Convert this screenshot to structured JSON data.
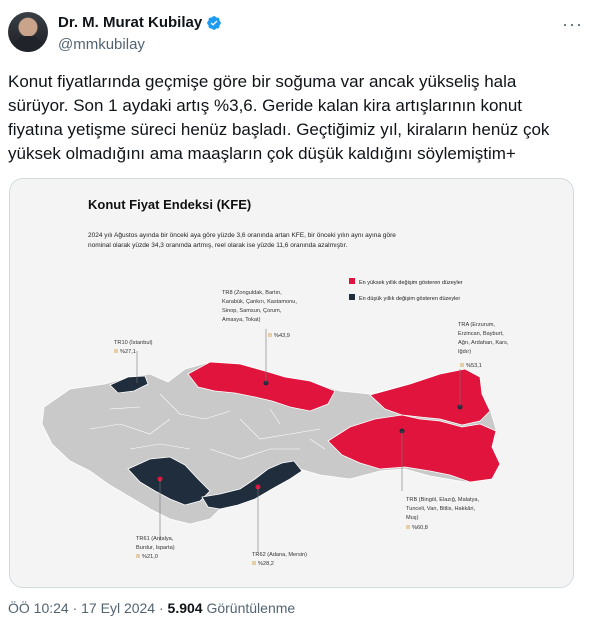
{
  "author": {
    "name": "Dr. M. Murat Kubilay",
    "handle": "@mmkubilay",
    "more_icon": "···"
  },
  "post_text": "Konut fiyatlarında geçmişe göre bir soğuma var ancak yükseliş hala sürüyor. Son 1 aydaki artış %3,6. Geride kalan kira artışlarının konut fiyatına yetişme süreci henüz başladı. Geçtiğimiz yıl, kiraların henüz çok yüksek olmadığını ama maaşların çok düşük kaldığını söylemiştim+",
  "infographic": {
    "title": "Konut Fiyat Endeksi (KFE)",
    "line1": "2024 yılı Ağustos ayında bir önceki aya göre yüzde 3,6 oranında artan KFE, bir önceki yılın aynı ayına göre",
    "line2": "nominal olarak yüzde 34,3 oranında artmış, reel olarak ise yüzde 11,6 oranında azalmıştır.",
    "legend_high": "En yüksek yıllık değişim gösteren düzeyler",
    "legend_low": "En düşük yıllık değişim gösteren düzeyler",
    "colors": {
      "high": "#e0143c",
      "low": "#1f2d3d",
      "neutral": "#c9c9c9",
      "badge": "#e6cfa8"
    },
    "regions": {
      "tr10": {
        "name": "TR10 (İstanbul)",
        "value": "%27,1"
      },
      "tr8_lines": [
        "TR8 (Zonguldak, Bartın,",
        "Karabük, Çankırı, Kastamonu,",
        "Sinop, Samsun, Çorum,",
        "Amasya, Tokat)"
      ],
      "tr8_value": "%43,9",
      "tra_lines": [
        "TRA (Erzurum,",
        "Erzincan, Bayburt,",
        "Ağrı, Ardahan, Kars,",
        "Iğdır)"
      ],
      "tra_value": "%53,1",
      "trb_lines": [
        "TRB (Bingöl, Elazığ, Malatya,",
        "Tunceli, Van, Bitlis, Hakkâri,",
        "Muş)"
      ],
      "trb_value": "%60,8",
      "tr61_lines": [
        "TR61 (Antalya,",
        "Burdur, Isparta)"
      ],
      "tr61_value": "%21,0",
      "tr62_name": "TR62 (Adana, Mersin)",
      "tr62_value": "%28,2"
    }
  },
  "footer": {
    "timestamp": "ÖÖ 10:24 · 17 Eyl 2024 · ",
    "views": "5.904",
    "views_label": " Görüntülenme"
  }
}
